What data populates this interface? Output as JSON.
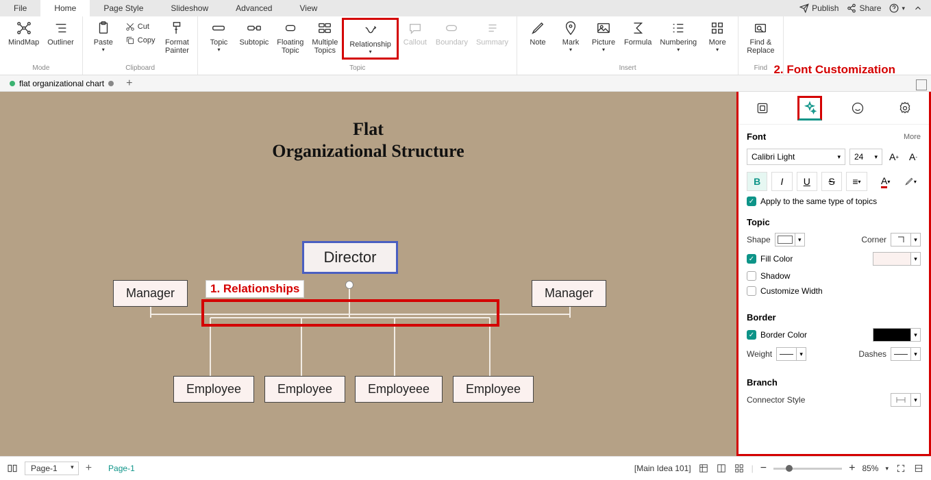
{
  "menubar": {
    "tabs": [
      "File",
      "Home",
      "Page Style",
      "Slideshow",
      "Advanced",
      "View"
    ],
    "publish": "Publish",
    "share": "Share"
  },
  "ribbon": {
    "mode_label": "Mode",
    "mindmap": "MindMap",
    "outliner": "Outliner",
    "clipboard_label": "Clipboard",
    "paste": "Paste",
    "cut": "Cut",
    "copy": "Copy",
    "format_painter": "Format\nPainter",
    "topic_label": "Topic",
    "topic": "Topic",
    "subtopic": "Subtopic",
    "floating_topic": "Floating\nTopic",
    "multiple_topics": "Multiple\nTopics",
    "relationship": "Relationship",
    "callout": "Callout",
    "boundary": "Boundary",
    "summary": "Summary",
    "insert_label": "Insert",
    "note": "Note",
    "mark": "Mark",
    "picture": "Picture",
    "formula": "Formula",
    "numbering": "Numbering",
    "more": "More",
    "find_label": "Find",
    "find_replace": "Find &\nReplace"
  },
  "doctab": {
    "name": "flat organizational chart"
  },
  "canvas": {
    "title1": "Flat",
    "title2": "Organizational Structure",
    "director": "Director",
    "manager": "Manager",
    "employee": "Employee",
    "employeee": "Employeee"
  },
  "annotations": {
    "a1": "1. Relationships",
    "a2": "2. Font Customization"
  },
  "rightpanel": {
    "font_heading": "Font",
    "more": "More",
    "font_family": "Calibri Light",
    "font_size": "24",
    "apply_same": "Apply to the same type of topics",
    "topic_heading": "Topic",
    "shape": "Shape",
    "corner": "Corner",
    "fill_color": "Fill Color",
    "shadow": "Shadow",
    "cust_width": "Customize Width",
    "border_heading": "Border",
    "border_color": "Border Color",
    "weight": "Weight",
    "dashes": "Dashes",
    "branch_heading": "Branch",
    "connector": "Connector Style"
  },
  "statusbar": {
    "page_sel": "Page-1",
    "page_lbl": "Page-1",
    "main_idea": "[Main Idea 101]",
    "zoom": "85%"
  }
}
